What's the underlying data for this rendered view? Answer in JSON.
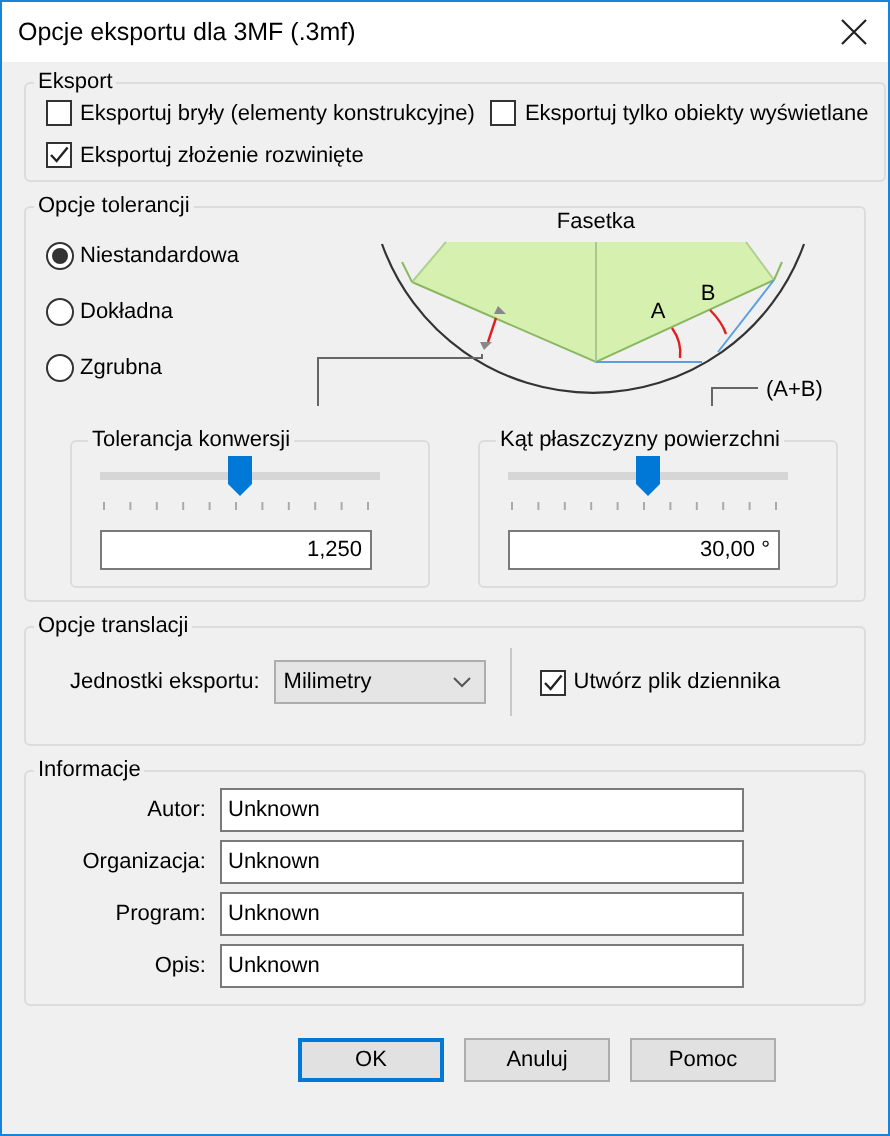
{
  "window": {
    "title": "Opcje eksportu dla 3MF (.3mf)"
  },
  "export_group": {
    "label": "Eksport",
    "options": [
      {
        "label": "Eksportuj bryły (elementy konstrukcyjne)",
        "checked": false
      },
      {
        "label": "Eksportuj tylko obiekty wyświetlane",
        "checked": false
      },
      {
        "label": "Eksportuj złożenie rozwinięte",
        "checked": true
      }
    ]
  },
  "tolerance_group": {
    "label": "Opcje tolerancji",
    "modes": [
      {
        "label": "Niestandardowa",
        "selected": true
      },
      {
        "label": "Dokładna",
        "selected": false
      },
      {
        "label": "Zgrubna",
        "selected": false
      }
    ],
    "diagram": {
      "title": "Fasetka",
      "label_a": "A",
      "label_b": "B",
      "sum_label": "(A+B)"
    },
    "sliders": [
      {
        "label": "Tolerancja konwersji",
        "level": 0.5,
        "value": "1,250"
      },
      {
        "label": "Kąt płaszczyzny powierzchni",
        "level": 0.5,
        "value": "30,00 °"
      }
    ]
  },
  "translation_group": {
    "label": "Opcje translacji",
    "units_label": "Jednostki eksportu:",
    "units": "Milimetry",
    "log_file": {
      "label": "Utwórz plik dziennika",
      "checked": true
    }
  },
  "info_group": {
    "label": "Informacje",
    "fields": [
      {
        "label": "Autor:",
        "value": "Unknown"
      },
      {
        "label": "Organizacja:",
        "value": "Unknown"
      },
      {
        "label": "Program:",
        "value": "Unknown"
      },
      {
        "label": "Opis:",
        "value": "Unknown"
      }
    ]
  },
  "buttons": [
    {
      "label": "OK",
      "default": true
    },
    {
      "label": "Anuluj",
      "default": false
    },
    {
      "label": "Pomoc",
      "default": false
    }
  ]
}
